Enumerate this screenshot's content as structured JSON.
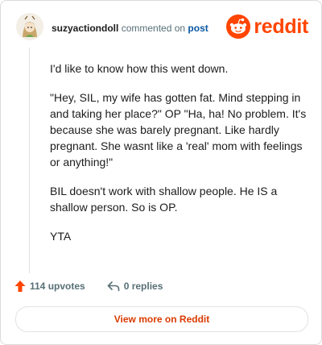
{
  "header": {
    "username": "suzyactiondoll",
    "commented_text": "commented on",
    "post_link": "post",
    "brand_name": "reddit",
    "brand_color": "#ff4500",
    "avatar_icon": "avatar-icon"
  },
  "comment": {
    "paragraphs": [
      "I'd like to know how this went down.",
      "\"Hey, SIL, my wife has gotten fat. Mind stepping in and taking her place?\" OP \"Ha, ha! No problem. It's because she was barely pregnant. Like hardly pregnant. She wasnt like a 'real' mom with feelings or anything!\"",
      "BIL doesn't work with shallow people. He IS a shallow person. So is OP.",
      "YTA"
    ]
  },
  "actions": {
    "upvotes": "114 upvotes",
    "replies": "0 replies",
    "upvote_icon": "upvote-arrow-icon",
    "reply_icon": "reply-arrow-icon"
  },
  "cta": {
    "label": "View more on Reddit"
  }
}
